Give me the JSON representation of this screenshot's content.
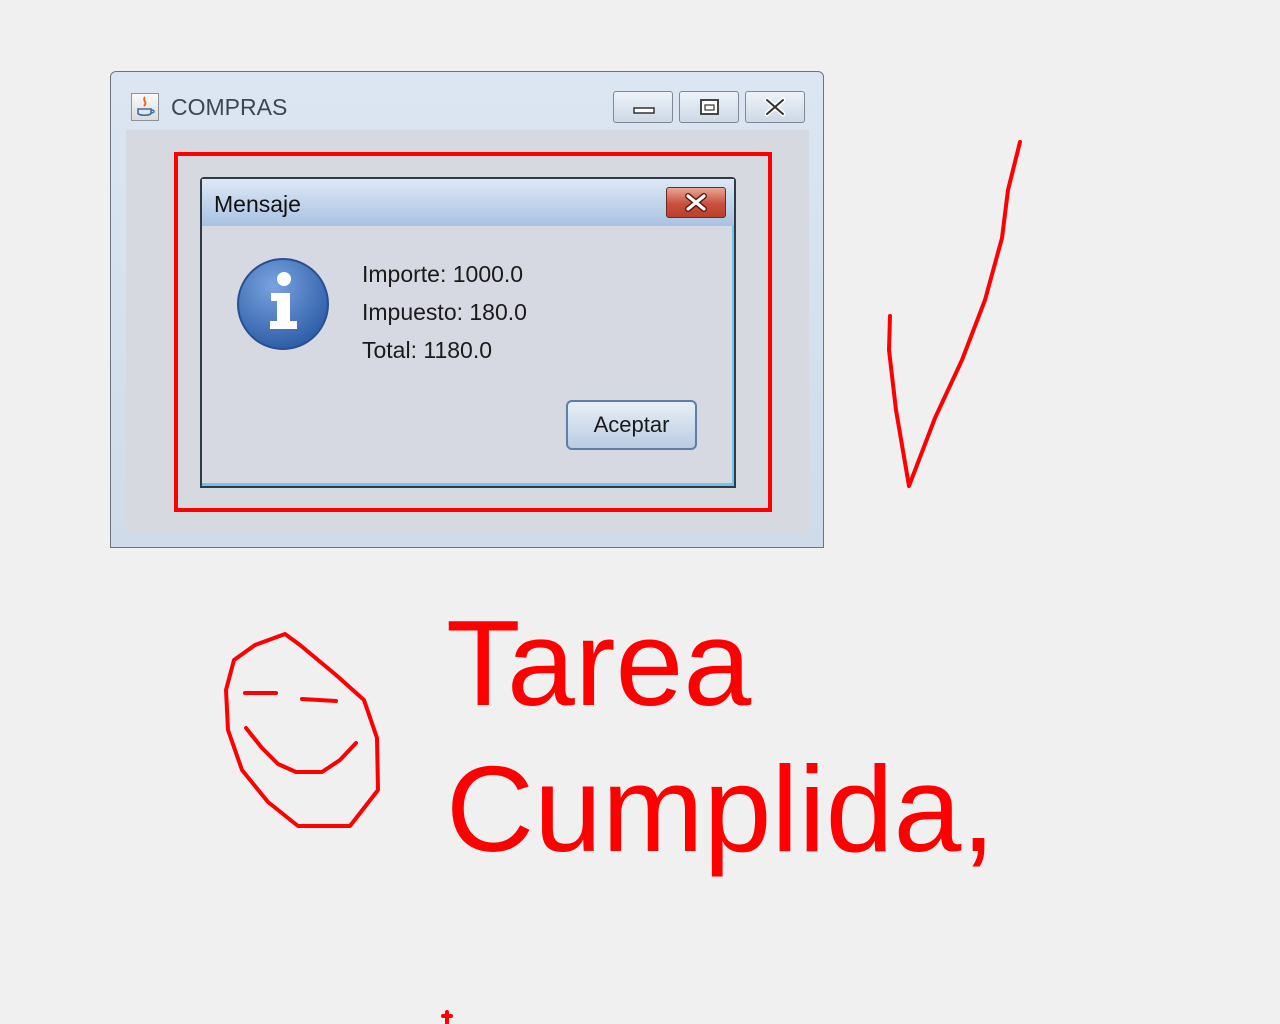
{
  "window": {
    "title": "COMPRAS"
  },
  "dialog": {
    "title": "Mensaje",
    "lines": [
      "Importe: 1000.0",
      "Impuesto: 180.0",
      "Total: 1180.0"
    ],
    "ok_label": "Aceptar"
  },
  "annotation": {
    "line1": "Tarea",
    "line2": "Cumplida,"
  },
  "colors": {
    "annotation_red": "#ff0000",
    "info_blue": "#2f5fa8"
  }
}
